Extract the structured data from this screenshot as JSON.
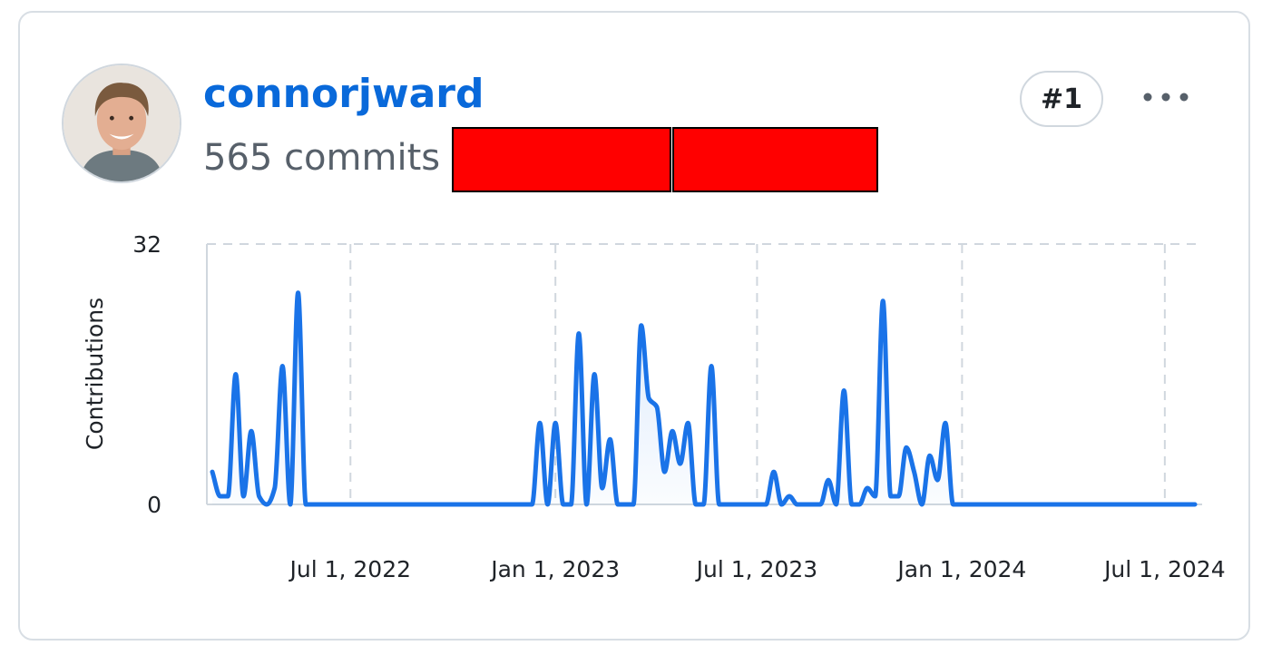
{
  "user": {
    "username": "connorjward",
    "commits_label": "565 commits",
    "rank": "#1",
    "more_icon": "kebab-horizontal-icon",
    "avatar_icon": "user-avatar-photo"
  },
  "colors": {
    "accent": "#0969da",
    "line": "#1a73e8",
    "border": "#d8dee4",
    "redaction": "#ff0000"
  },
  "chart_data": {
    "type": "area",
    "title": "",
    "ylabel": "Contributions",
    "xlabel": "",
    "ylim": [
      0,
      32
    ],
    "y_ticks": [
      "0",
      "32"
    ],
    "x_ticks": [
      "Jul 1, 2022",
      "Jan 1, 2023",
      "Jul 1, 2023",
      "Jan 1, 2024",
      "Jul 1, 2024"
    ],
    "grid": true,
    "x": [
      "2022-02-27",
      "2022-03-06",
      "2022-03-13",
      "2022-03-20",
      "2022-03-27",
      "2022-04-03",
      "2022-04-10",
      "2022-04-17",
      "2022-04-24",
      "2022-05-01",
      "2022-05-08",
      "2022-05-15",
      "2022-05-22",
      "2022-05-29",
      "2022-06-05",
      "2022-06-12",
      "2022-06-19",
      "2022-06-26",
      "2022-07-03",
      "2022-07-10",
      "2022-07-17",
      "2022-07-24",
      "2022-07-31",
      "2022-08-07",
      "2022-08-14",
      "2022-08-21",
      "2022-08-28",
      "2022-09-04",
      "2022-09-11",
      "2022-09-18",
      "2022-09-25",
      "2022-10-02",
      "2022-10-09",
      "2022-10-16",
      "2022-10-23",
      "2022-10-30",
      "2022-11-06",
      "2022-11-13",
      "2022-11-20",
      "2022-11-27",
      "2022-12-04",
      "2022-12-11",
      "2022-12-18",
      "2022-12-25",
      "2023-01-01",
      "2023-01-08",
      "2023-01-15",
      "2023-01-22",
      "2023-01-29",
      "2023-02-05",
      "2023-02-12",
      "2023-02-19",
      "2023-02-26",
      "2023-03-05",
      "2023-03-12",
      "2023-03-19",
      "2023-03-26",
      "2023-04-02",
      "2023-04-09",
      "2023-04-16",
      "2023-04-23",
      "2023-04-30",
      "2023-05-07",
      "2023-05-14",
      "2023-05-21",
      "2023-05-28",
      "2023-06-04",
      "2023-06-11",
      "2023-06-18",
      "2023-06-25",
      "2023-07-02",
      "2023-07-09",
      "2023-07-16",
      "2023-07-23",
      "2023-07-30",
      "2023-08-06",
      "2023-08-13",
      "2023-08-20",
      "2023-08-27",
      "2023-09-03",
      "2023-09-10",
      "2023-09-17",
      "2023-09-24",
      "2023-10-01",
      "2023-10-08",
      "2023-10-15",
      "2023-10-22",
      "2023-10-29",
      "2023-11-05",
      "2023-11-12",
      "2023-11-19",
      "2023-11-26",
      "2023-12-03",
      "2023-12-10",
      "2023-12-17",
      "2023-12-24",
      "2023-12-31",
      "2024-01-07",
      "2024-01-14",
      "2024-01-21",
      "2024-01-28",
      "2024-02-04",
      "2024-02-11",
      "2024-02-18",
      "2024-02-25",
      "2024-03-03",
      "2024-03-10",
      "2024-03-17",
      "2024-03-24",
      "2024-03-31",
      "2024-04-07",
      "2024-04-14",
      "2024-04-21",
      "2024-04-28",
      "2024-05-05",
      "2024-05-12",
      "2024-05-19",
      "2024-05-26",
      "2024-06-02",
      "2024-06-09",
      "2024-06-16",
      "2024-06-23",
      "2024-06-30",
      "2024-07-07",
      "2024-07-14",
      "2024-07-21",
      "2024-07-28"
    ],
    "series": [
      {
        "values": [
          4,
          1,
          1,
          16,
          1,
          9,
          1,
          0,
          2,
          17,
          0,
          26,
          0,
          0,
          0,
          0,
          0,
          0,
          0,
          0,
          0,
          0,
          0,
          0,
          0,
          0,
          0,
          0,
          0,
          0,
          0,
          0,
          0,
          0,
          0,
          0,
          0,
          0,
          0,
          0,
          0,
          0,
          10,
          0,
          10,
          0,
          0,
          21,
          0,
          16,
          2,
          8,
          0,
          0,
          0,
          22,
          13,
          12,
          4,
          9,
          5,
          10,
          0,
          0,
          17,
          0,
          0,
          0,
          0,
          0,
          0,
          0,
          4,
          0,
          1,
          0,
          0,
          0,
          0,
          3,
          0,
          14,
          0,
          0,
          2,
          1,
          25,
          1,
          1,
          7,
          4,
          0,
          6,
          3,
          10,
          0,
          0,
          0,
          0,
          0,
          0,
          0,
          0,
          0,
          0,
          0,
          0,
          0,
          0,
          0,
          0,
          0,
          0,
          0,
          0,
          0,
          0,
          0,
          0,
          0,
          0,
          0,
          0,
          0,
          0,
          0,
          0
        ]
      }
    ]
  }
}
